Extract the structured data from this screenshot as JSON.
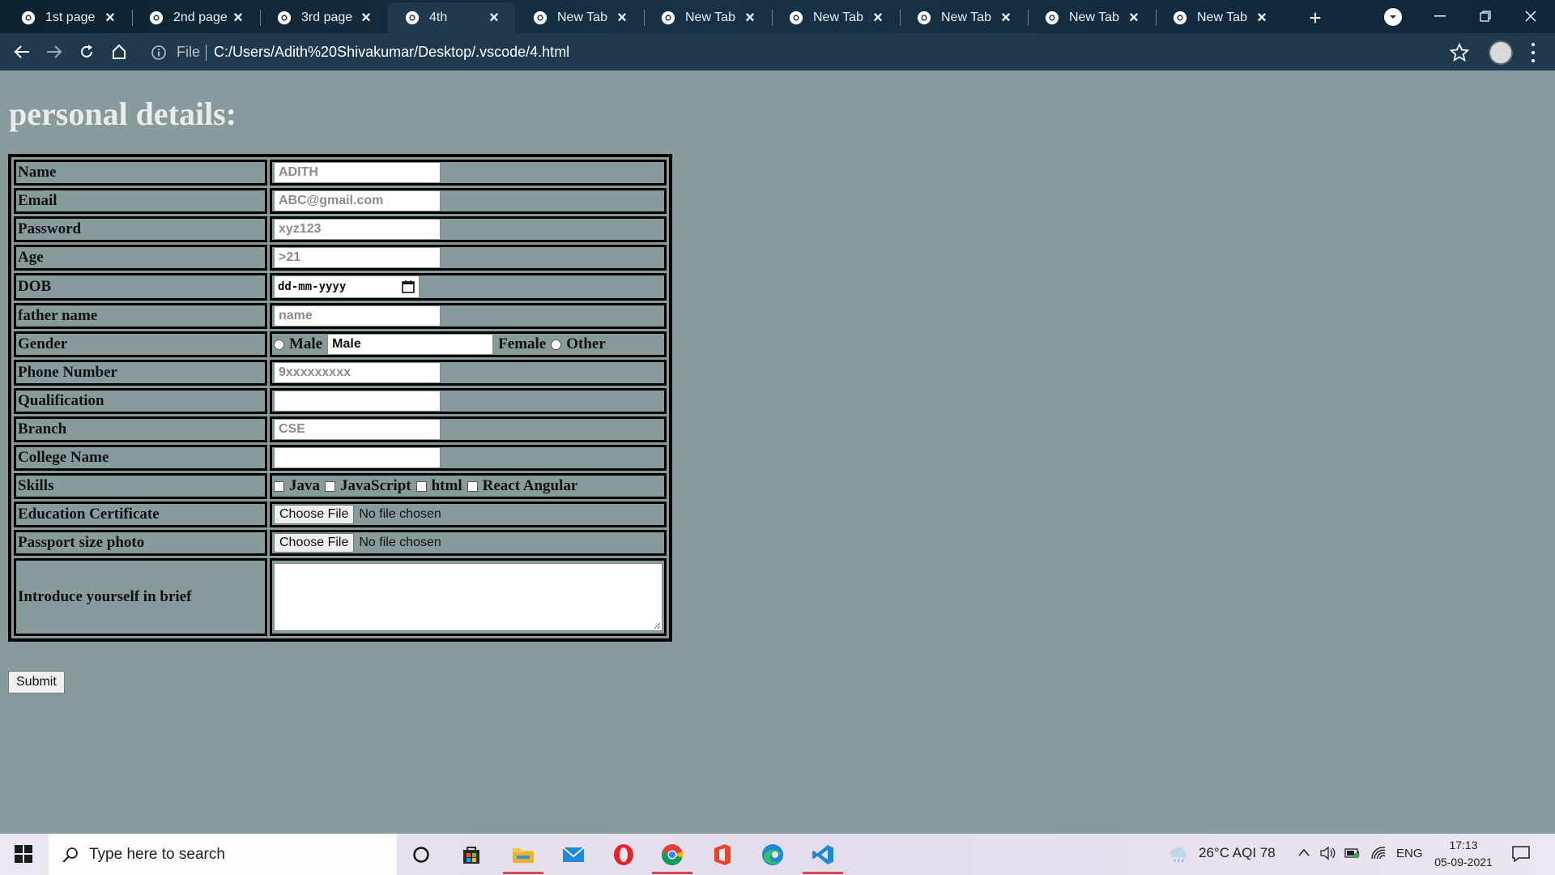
{
  "browser": {
    "tabs": [
      {
        "label": "1st page",
        "active": false
      },
      {
        "label": "2nd page",
        "active": false
      },
      {
        "label": "3rd page",
        "active": false
      },
      {
        "label": "4th",
        "active": true
      },
      {
        "label": "New Tab",
        "active": false
      },
      {
        "label": "New Tab",
        "active": false
      },
      {
        "label": "New Tab",
        "active": false
      },
      {
        "label": "New Tab",
        "active": false
      },
      {
        "label": "New Tab",
        "active": false
      },
      {
        "label": "New Tab",
        "active": false
      }
    ],
    "address": {
      "scheme_label": "File",
      "url": "C:/Users/Adith%20Shivakumar/Desktop/.vscode/4.html"
    }
  },
  "page": {
    "title": "personal details:",
    "rows": {
      "name": {
        "label": "Name",
        "placeholder": "ADITH"
      },
      "email": {
        "label": "Email",
        "placeholder": "ABC@gmail.com"
      },
      "password": {
        "label": "Password",
        "placeholder": "xyz123"
      },
      "age": {
        "label": "Age",
        "placeholder": ">21"
      },
      "dob": {
        "label": "DOB",
        "placeholder": "dd-mm-yyyy"
      },
      "father": {
        "label": "father name",
        "placeholder": "name"
      },
      "gender": {
        "label": "Gender",
        "male": "Male",
        "male_value": "Male",
        "female": "Female",
        "other": "Other"
      },
      "phone": {
        "label": "Phone Number",
        "placeholder": "9xxxxxxxxx"
      },
      "qualification": {
        "label": "Qualification",
        "placeholder": ""
      },
      "branch": {
        "label": "Branch",
        "placeholder": "CSE"
      },
      "college": {
        "label": "College Name",
        "placeholder": ""
      },
      "skills": {
        "label": "Skills",
        "options": [
          "Java",
          "JavaScript",
          "html",
          "React Angular"
        ]
      },
      "edu_cert": {
        "label": "Education Certificate",
        "button": "Choose File",
        "status": "No file chosen"
      },
      "photo": {
        "label": "Passport size photo",
        "button": "Choose File",
        "status": "No file chosen"
      },
      "intro": {
        "label": "Introduce yourself in brief"
      }
    },
    "submit_label": "Submit"
  },
  "taskbar": {
    "search_placeholder": "Type here to search",
    "weather": "26°C  AQI 78",
    "language": "ENG",
    "time": "17:13",
    "date": "05-09-2021"
  }
}
